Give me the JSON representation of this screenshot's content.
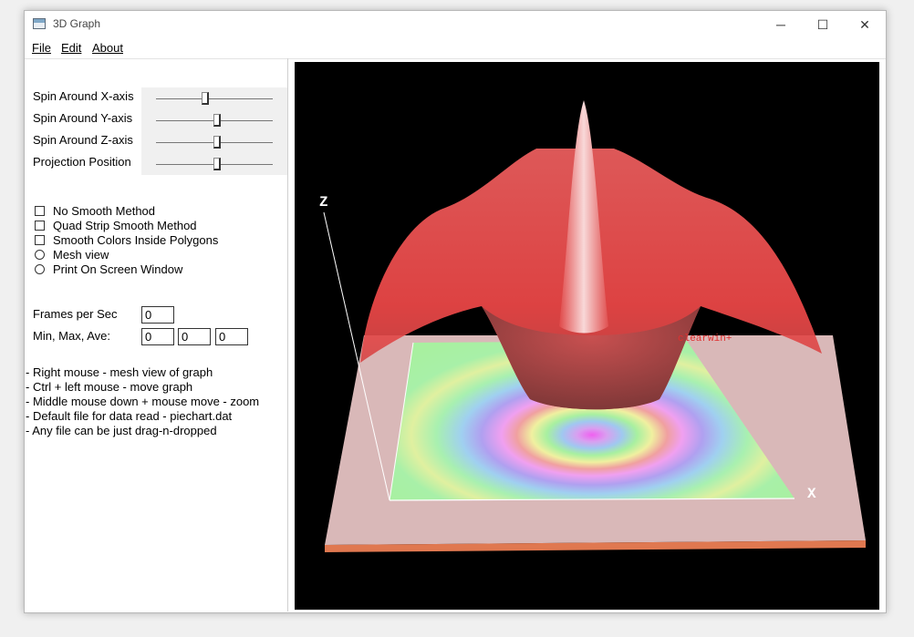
{
  "window": {
    "title": "3D Graph",
    "minimize_glyph": "─",
    "maximize_glyph": "☐",
    "close_glyph": "✕"
  },
  "menu": {
    "file": "File",
    "edit": "Edit",
    "about": "About"
  },
  "sliders": [
    {
      "label": "Spin Around X-axis",
      "value": 0.42
    },
    {
      "label": "Spin Around Y-axis",
      "value": 0.52
    },
    {
      "label": "Spin Around Z-axis",
      "value": 0.52
    },
    {
      "label": "Projection Position",
      "value": 0.52
    }
  ],
  "options": [
    {
      "label": "No Smooth Method",
      "type": "checkbox",
      "checked": false
    },
    {
      "label": "Quad Strip Smooth Method",
      "type": "checkbox",
      "checked": false
    },
    {
      "label": "Smooth Colors Inside Polygons",
      "type": "checkbox",
      "checked": false
    },
    {
      "label": "Mesh view",
      "type": "radio",
      "checked": false
    },
    {
      "label": "Print On Screen Window",
      "type": "radio",
      "checked": false
    }
  ],
  "stats": {
    "fps_label": "Frames per Sec",
    "fps_value": "0",
    "minmax_label": "Min, Max, Ave:",
    "min_value": "0",
    "max_value": "0",
    "ave_value": "0"
  },
  "help_lines": [
    "- Right mouse - mesh view of graph",
    "- Ctrl + left mouse - move graph",
    "- Middle mouse down + mouse move - zoom",
    "- Default file for data read - piechart.dat",
    "- Any file can be just drag-n-dropped"
  ],
  "plot": {
    "z_axis_label": "Z",
    "x_axis_label": "X",
    "watermark": "clearwin+",
    "surface_color": "#f05050",
    "base_color": "#d9b8b8",
    "background": "#000000"
  }
}
